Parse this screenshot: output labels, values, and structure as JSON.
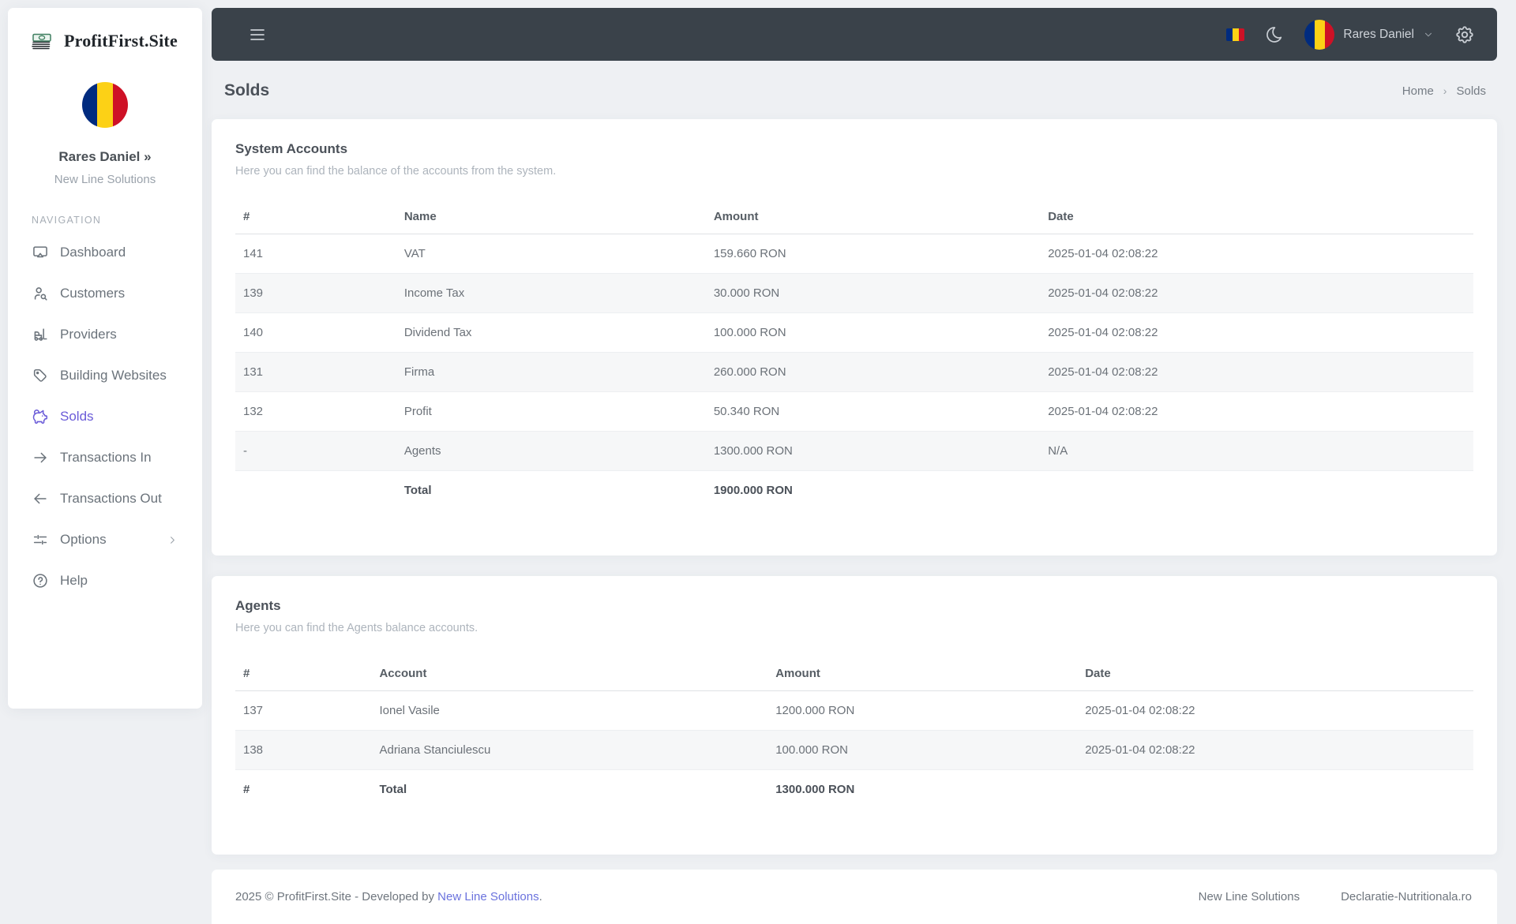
{
  "brand": {
    "name": "ProfitFirst.Site",
    "logo_icon": "money-stack-icon"
  },
  "colors": {
    "accent": "#6a5bd8",
    "link": "#6a72dd",
    "topbar_bg": "#3a424a",
    "page_bg": "#eef0f3",
    "flag": [
      "#002b7f",
      "#fcd116",
      "#ce1126"
    ]
  },
  "topbar": {
    "user_name": "Rares Daniel",
    "icons": [
      "menu-icon",
      "flag-ro-icon",
      "moon-icon",
      "chevron-down-icon",
      "gear-icon"
    ]
  },
  "sidebar": {
    "user": {
      "name": "Rares Daniel »",
      "company": "New Line Solutions"
    },
    "nav_header": "NAVIGATION",
    "items": [
      {
        "label": "Dashboard",
        "icon": "dashboard-icon",
        "active": false
      },
      {
        "label": "Customers",
        "icon": "user-search-icon",
        "active": false
      },
      {
        "label": "Providers",
        "icon": "forklift-icon",
        "active": false
      },
      {
        "label": "Building Websites",
        "icon": "tag-icon",
        "active": false
      },
      {
        "label": "Solds",
        "icon": "piggy-bank-icon",
        "active": true
      },
      {
        "label": "Transactions In",
        "icon": "arrow-right-icon",
        "active": false
      },
      {
        "label": "Transactions Out",
        "icon": "arrow-left-icon",
        "active": false
      },
      {
        "label": "Options",
        "icon": "sliders-icon",
        "active": false,
        "chevron": true
      },
      {
        "label": "Help",
        "icon": "help-circle-icon",
        "active": false
      }
    ]
  },
  "page": {
    "title": "Solds",
    "breadcrumb": {
      "home": "Home",
      "separator": "›",
      "current": "Solds"
    }
  },
  "system_accounts": {
    "title": "System Accounts",
    "subtitle": "Here you can find the balance of the accounts from the system.",
    "columns": [
      "#",
      "Name",
      "Amount",
      "Date"
    ],
    "rows": [
      {
        "cells": [
          "141",
          "VAT",
          "159.660 RON",
          "2025-01-04 02:08:22"
        ]
      },
      {
        "cells": [
          "139",
          "Income Tax",
          "30.000 RON",
          "2025-01-04 02:08:22"
        ]
      },
      {
        "cells": [
          "140",
          "Dividend Tax",
          "100.000 RON",
          "2025-01-04 02:08:22"
        ]
      },
      {
        "cells": [
          "131",
          "Firma",
          "260.000 RON",
          "2025-01-04 02:08:22"
        ]
      },
      {
        "cells": [
          "132",
          "Profit",
          "50.340 RON",
          "2025-01-04 02:08:22"
        ]
      },
      {
        "cells": [
          "-",
          "Agents",
          "1300.000 RON",
          "N/A"
        ]
      },
      {
        "cells": [
          "",
          "Total",
          "1900.000 RON",
          ""
        ],
        "bold": true
      }
    ]
  },
  "agents": {
    "title": "Agents",
    "subtitle": "Here you can find the Agents balance accounts.",
    "columns": [
      "#",
      "Account",
      "Amount",
      "Date"
    ],
    "rows": [
      {
        "cells": [
          "137",
          "Ionel Vasile",
          "1200.000 RON",
          "2025-01-04 02:08:22"
        ]
      },
      {
        "cells": [
          "138",
          "Adriana Stanciulescu",
          "100.000 RON",
          "2025-01-04 02:08:22"
        ]
      },
      {
        "cells": [
          "#",
          "Total",
          "1300.000 RON",
          ""
        ],
        "bold": true
      }
    ]
  },
  "footer": {
    "copyright_prefix": "2025 © ProfitFirst.Site - Developed by ",
    "copyright_link": "New Line Solutions",
    "copyright_suffix": ".",
    "links": [
      "New Line Solutions",
      "Declaratie-Nutritionala.ro"
    ]
  }
}
